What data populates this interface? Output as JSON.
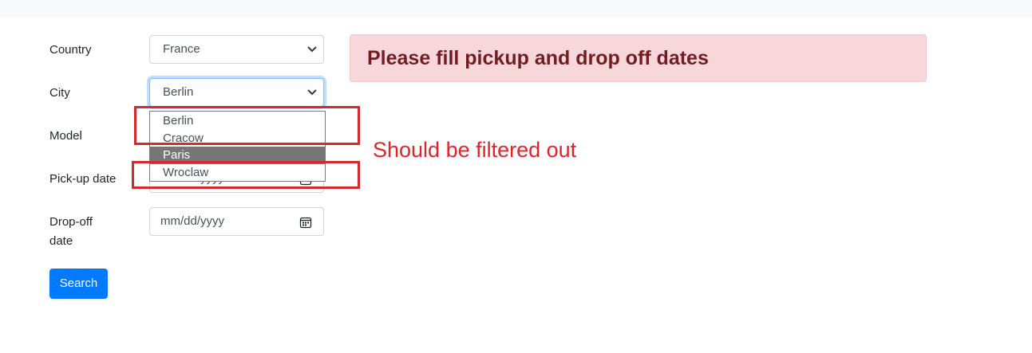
{
  "form": {
    "country": {
      "label": "Country",
      "value": "France"
    },
    "city": {
      "label": "City",
      "value": "Berlin"
    },
    "model": {
      "label": "Model"
    },
    "pickup": {
      "label": "Pick-up date",
      "placeholder": "mm/dd/yyyy"
    },
    "dropoff": {
      "label_line1": "Drop-off",
      "label_line2": "date",
      "placeholder": "mm/dd/yyyy"
    },
    "search_label": "Search"
  },
  "city_dropdown": {
    "options": [
      "Berlin",
      "Cracow",
      "Paris",
      "Wroclaw"
    ],
    "highlighted": "Paris"
  },
  "alert": {
    "text": "Please fill pickup and drop off dates",
    "background": "#f8d7da",
    "color": "#721c24"
  },
  "annotation": {
    "text": "Should be filtered out",
    "color": "#e0242a"
  },
  "icons": [
    "chevron-down-icon",
    "calendar-icon"
  ],
  "colors": {
    "primary": "#007bff",
    "annotation_box": "#d52a2a"
  }
}
